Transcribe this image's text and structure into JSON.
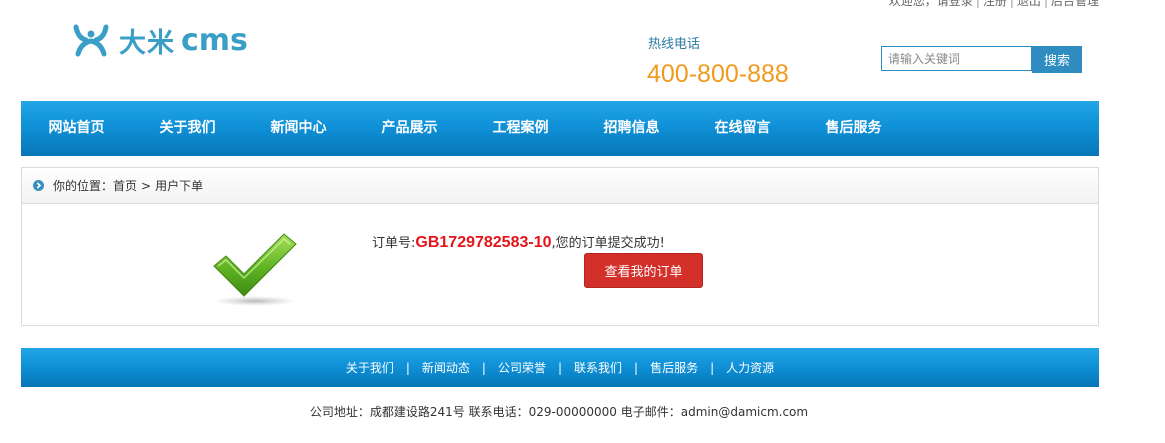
{
  "topbar": {
    "welcome": "欢迎您，请",
    "login": "登录",
    "register": "注册",
    "logout": "退出",
    "admin": "后台管理"
  },
  "brand": {
    "name_cn": "大米",
    "name_en": "cms",
    "color": "#3a9fc7"
  },
  "hotline": {
    "label": "热线电话",
    "number": "400-800-888",
    "number_color": "#f09a1e"
  },
  "search": {
    "placeholder": "请输入关键词",
    "button": "搜索"
  },
  "nav": {
    "items": [
      "网站首页",
      "关于我们",
      "新闻中心",
      "产品展示",
      "工程案例",
      "招聘信息",
      "在线留言",
      "售后服务"
    ]
  },
  "breadcrumb": {
    "prefix": "你的位置：",
    "home": "首页",
    "separator": ">",
    "current": "用户下单"
  },
  "order": {
    "label": "订单号:",
    "number": "GB1729782583-10",
    "message": ",您的订单提交成功!",
    "view_button": "查看我的订单",
    "icon": "check-icon"
  },
  "footer_nav": {
    "items": [
      "关于我们",
      "新闻动态",
      "公司荣誉",
      "联系我们",
      "售后服务",
      "人力资源"
    ],
    "separator": "|"
  },
  "footer_info": {
    "text": "公司地址：成都建设路241号 联系电话：029-00000000 电子邮件：admin@damicm.com"
  },
  "colors": {
    "nav_blue": "#0e8fd6",
    "button_red": "#d4302a",
    "order_red": "#e4141b"
  }
}
